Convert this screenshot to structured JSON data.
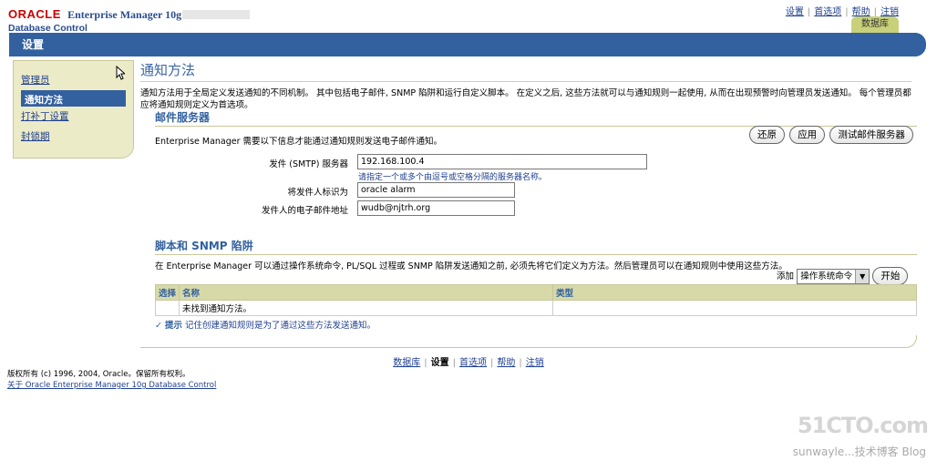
{
  "header": {
    "brand_oracle": "ORACLE",
    "brand_em": "Enterprise Manager 10g",
    "brand_sub": "Database Control",
    "links": [
      "设置",
      "首选项",
      "帮助",
      "注销"
    ],
    "db_tab": "数据库"
  },
  "titlebar": {
    "title": "设置"
  },
  "sidenav": {
    "items": [
      {
        "label": "管理员",
        "active": false
      },
      {
        "label": "通知方法",
        "active": true
      },
      {
        "label": "打补丁设置",
        "active": false
      },
      {
        "label": "封锁期",
        "active": false
      }
    ]
  },
  "main": {
    "title": "通知方法",
    "intro": "通知方法用于全局定义发送通知的不同机制。 其中包括电子邮件, SNMP 陷阱和运行自定义脚本。 在定义之后, 这些方法就可以与通知规则一起使用, 从而在出现预警时向管理员发送通知。 每个管理员都应将通知规则定义为首选项。",
    "mail": {
      "heading": "邮件服务器",
      "desc": "Enterprise Manager 需要以下信息才能通过通知规则发送电子邮件通知。",
      "buttons": {
        "revert": "还原",
        "apply": "应用",
        "test": "测试邮件服务器"
      },
      "smtp_label": "发件 (SMTP) 服务器",
      "smtp_value": "192.168.100.4",
      "smtp_hint": "请指定一个或多个由逗号或空格分隔的服务器名称。",
      "sender_label": "将发件人标识为",
      "sender_value": "oracle alarm",
      "email_label": "发件人的电子邮件地址",
      "email_value": "wudb@njtrh.org"
    },
    "scripts": {
      "heading": "脚本和 SNMP 陷阱",
      "desc": "在 Enterprise Manager 可以通过操作系统命令, PL/SQL 过程或 SNMP 陷阱发送通知之前, 必须先将它们定义为方法。然后管理员可以在通知规则中使用这些方法。",
      "add_label": "添加",
      "add_select": "操作系统命令",
      "go_button": "开始",
      "table": {
        "headers": [
          "选择",
          "名称",
          "类型"
        ],
        "empty": "未找到通知方法。"
      },
      "tip_label": "提示",
      "tip_text": "记住创建通知规则是为了通过这些方法发送通知。"
    }
  },
  "footer": {
    "links": [
      "数据库",
      "设置",
      "首选项",
      "帮助",
      "注销"
    ],
    "copyright": "版权所有 (c) 1996, 2004, Oracle。保留所有权利。",
    "about": "关于 Oracle Enterprise Manager 10g Database Control"
  },
  "watermark": {
    "main": "51CTO.com",
    "sub": "sunwayle...技术博客 Blog"
  }
}
